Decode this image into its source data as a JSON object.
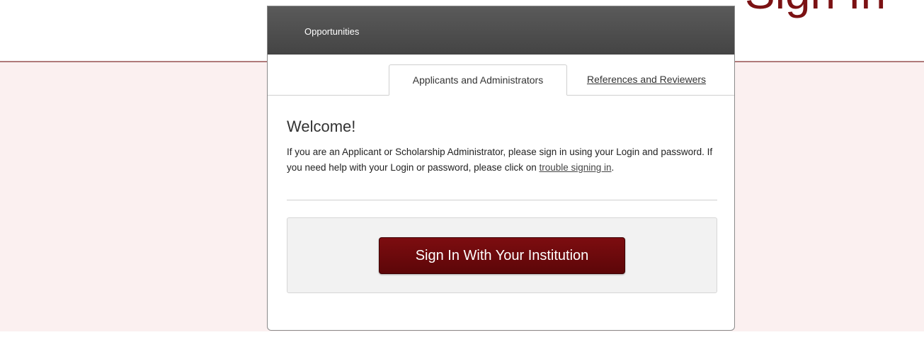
{
  "page": {
    "headline": "Sign In"
  },
  "card": {
    "header_link": "Opportunities",
    "tabs": [
      {
        "label": "Applicants and Administrators",
        "active": true
      },
      {
        "label": "References and Reviewers",
        "active": false
      }
    ],
    "welcome_title": "Welcome!",
    "intro_text": "If you are an Applicant or Scholarship Administrator, please sign in using your Login and password. If you need help with your Login or password, please click on ",
    "trouble_link": "trouble signing in",
    "intro_end": ".",
    "signin_button": "Sign In With Your Institution"
  },
  "colors": {
    "brand": "#7b1113",
    "header_bg": "#4f4f4f",
    "page_band": "#fbf0f0"
  }
}
